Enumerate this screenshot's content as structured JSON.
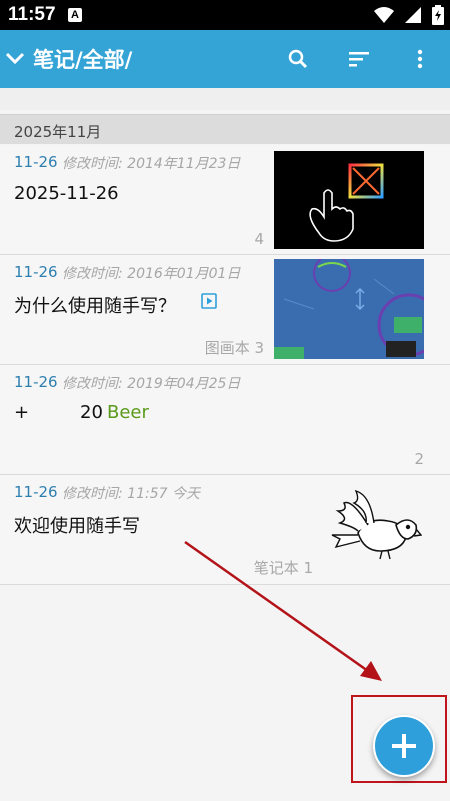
{
  "status": {
    "time": "11:57",
    "a_badge": "A"
  },
  "appbar": {
    "title": "笔记/全部/"
  },
  "date_header": "2025年11月",
  "notes": [
    {
      "date": "11-26",
      "mtime": "修改时间: 2014年11月23日",
      "title": "2025-11-26",
      "count": "4"
    },
    {
      "date": "11-26",
      "mtime": "修改时间: 2016年01月01日",
      "title": "为什么使用随手写？",
      "count": "图画本 3"
    },
    {
      "date": "11-26",
      "mtime": "修改时间: 2019年04月25日",
      "title_plus": "+",
      "title_num": "20",
      "title_word": "Beer",
      "count": "2"
    },
    {
      "date": "11-26",
      "mtime": "修改时间: 11:57 今天",
      "title": "欢迎使用随手写",
      "count": "笔记本 1"
    }
  ],
  "colors": {
    "appbar": "#34a3d6",
    "accent_date": "#2d7fb0",
    "fab": "#2e9fdb",
    "beer": "#5a9a1a",
    "annotation": "#c0141d"
  },
  "icons": [
    "chevron-down-icon",
    "search-icon",
    "sort-icon",
    "more-vert-icon",
    "play-icon",
    "add-icon",
    "wifi-icon",
    "signal-icon",
    "battery-icon"
  ]
}
